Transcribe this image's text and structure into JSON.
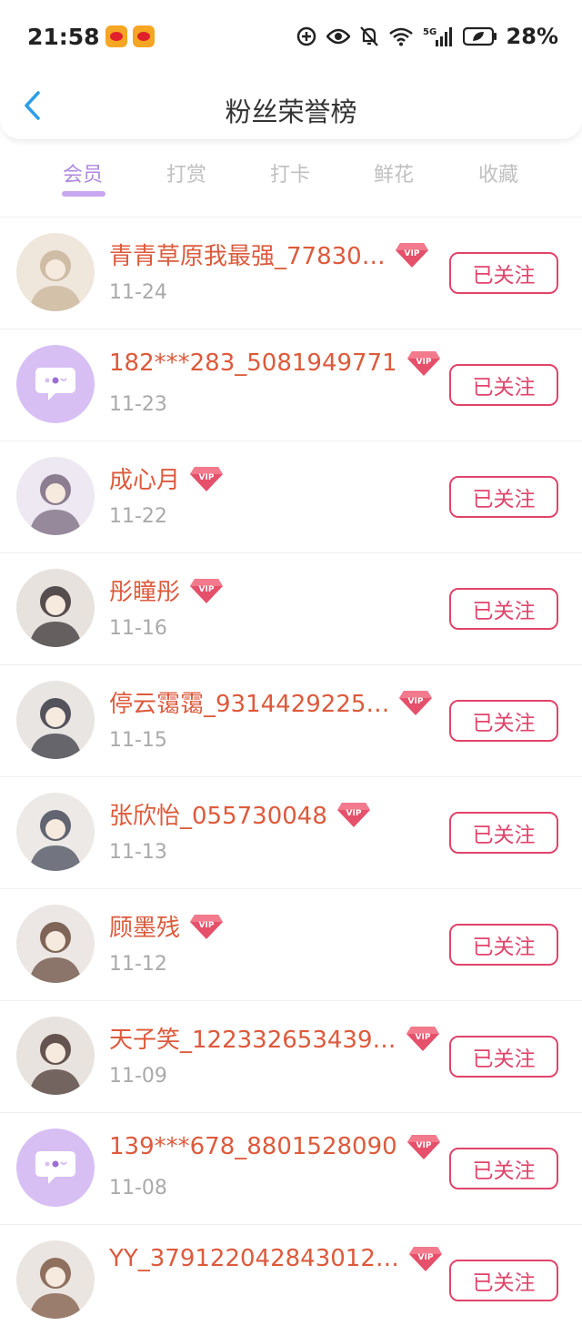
{
  "status_bar": {
    "time": "21:58",
    "battery": "28%",
    "icons": [
      "weibo-icon",
      "weibo-icon",
      "data-saver-icon",
      "eye-icon",
      "mute-icon",
      "wifi-icon",
      "5g-signal-icon",
      "battery-icon"
    ]
  },
  "header": {
    "title": "粉丝荣誉榜",
    "back_icon": "chevron-left-icon"
  },
  "tabs": [
    {
      "label": "会员",
      "active": true
    },
    {
      "label": "打赏",
      "active": false
    },
    {
      "label": "打卡",
      "active": false
    },
    {
      "label": "鲜花",
      "active": false
    },
    {
      "label": "收藏",
      "active": false
    }
  ],
  "colors": {
    "accent": "#b089e0",
    "name": "#dd5a3c",
    "button": "#e0446a",
    "date": "#aaaaaa"
  },
  "fans": [
    {
      "name": "青青草原我最强_77830…",
      "date": "11-24",
      "vip": "VIP",
      "button": "已关注",
      "avatar": "photo"
    },
    {
      "name": "182***283_5081949771",
      "date": "11-23",
      "vip": "VIP",
      "button": "已关注",
      "avatar": "default"
    },
    {
      "name": "成心月",
      "date": "11-22",
      "vip": "VIP",
      "button": "已关注",
      "avatar": "photo"
    },
    {
      "name": "彤瞳彤",
      "date": "11-16",
      "vip": "VIP",
      "button": "已关注",
      "avatar": "photo"
    },
    {
      "name": "停云霭霭_9314429225…",
      "date": "11-15",
      "vip": "VIP",
      "button": "已关注",
      "avatar": "photo"
    },
    {
      "name": "张欣怡_055730048",
      "date": "11-13",
      "vip": "VIP",
      "button": "已关注",
      "avatar": "photo"
    },
    {
      "name": "顾墨残",
      "date": "11-12",
      "vip": "VIP",
      "button": "已关注",
      "avatar": "photo"
    },
    {
      "name": "天子笑_122332653439…",
      "date": "11-09",
      "vip": "VIP",
      "button": "已关注",
      "avatar": "photo"
    },
    {
      "name": "139***678_8801528090",
      "date": "11-08",
      "vip": "VIP",
      "button": "已关注",
      "avatar": "default"
    },
    {
      "name": "YY_379122042843012…",
      "date": "",
      "vip": "VIP",
      "button": "已关注",
      "avatar": "photo"
    }
  ]
}
